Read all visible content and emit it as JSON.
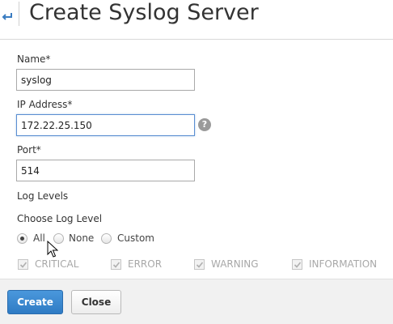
{
  "header": {
    "title": "Create Syslog Server",
    "back_icon": "back-arrow-icon"
  },
  "form": {
    "name": {
      "label": "Name*",
      "value": "syslog"
    },
    "ip_address": {
      "label": "IP Address*",
      "value": "172.22.25.150",
      "help_icon": "?"
    },
    "port": {
      "label": "Port*",
      "value": "514"
    },
    "log_levels_label": "Log Levels",
    "choose_log_level_label": "Choose Log Level",
    "radio_options": [
      {
        "label": "All",
        "checked": true
      },
      {
        "label": "None",
        "checked": false
      },
      {
        "label": "Custom",
        "checked": false
      }
    ],
    "levels": [
      {
        "label": "CRITICAL",
        "checked": true,
        "disabled": true
      },
      {
        "label": "ERROR",
        "checked": true,
        "disabled": true
      },
      {
        "label": "WARNING",
        "checked": true,
        "disabled": true
      },
      {
        "label": "INFORMATION",
        "checked": true,
        "disabled": true
      }
    ]
  },
  "footer": {
    "create_label": "Create",
    "close_label": "Close"
  },
  "colors": {
    "primary_button": "#2f7bc4",
    "focus_border": "#5b8fd1",
    "disabled_text": "#a8a8a8"
  }
}
